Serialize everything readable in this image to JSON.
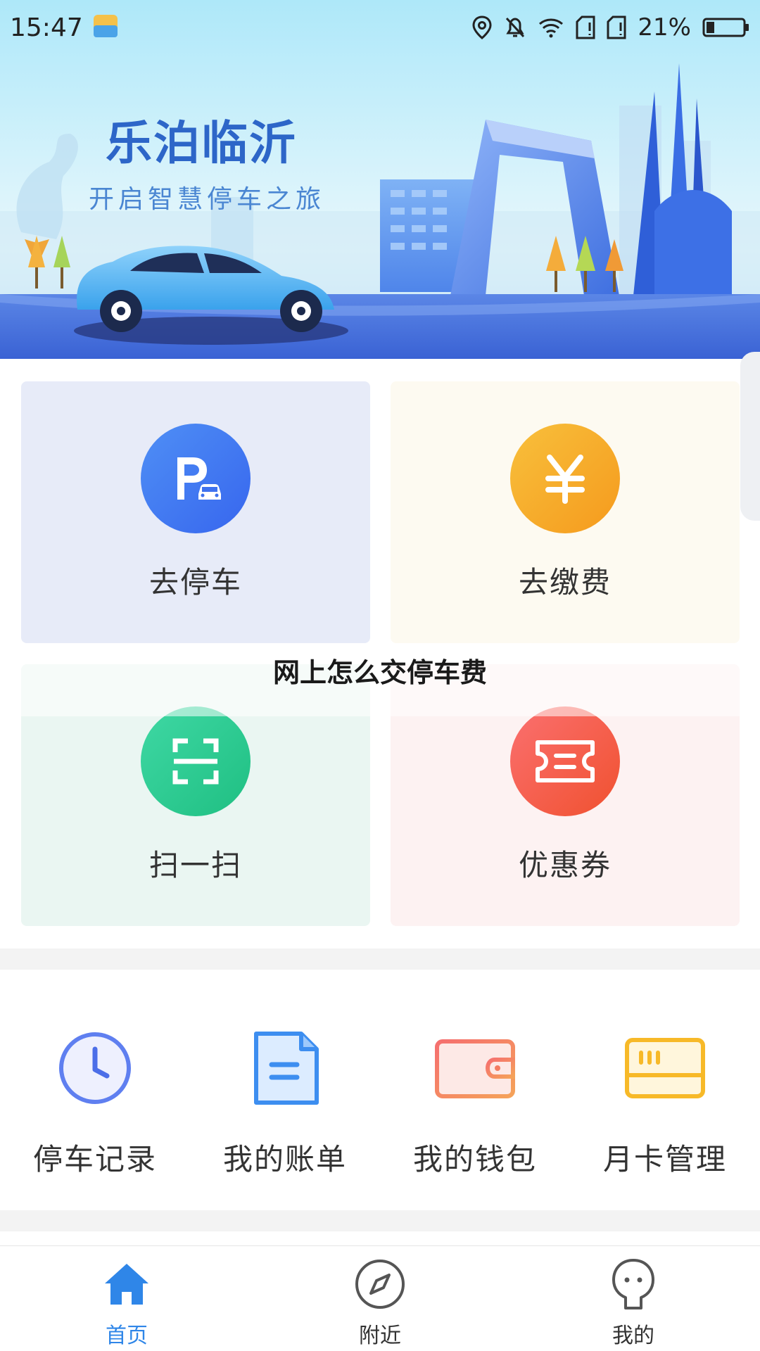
{
  "status_bar": {
    "time": "15:47",
    "battery_percent": "21%",
    "icons": [
      "weather-icon",
      "location-icon",
      "bell-off-icon",
      "wifi-icon",
      "sim1-icon",
      "sim2-icon",
      "battery-icon"
    ]
  },
  "banner": {
    "title": "乐泊临沂",
    "subtitle": "开启智慧停车之旅"
  },
  "tiles": [
    {
      "label": "去停车",
      "icon": "parking-car-icon"
    },
    {
      "label": "去缴费",
      "icon": "yuan-icon"
    },
    {
      "label": "扫一扫",
      "icon": "scan-icon"
    },
    {
      "label": "优惠券",
      "icon": "ticket-icon"
    }
  ],
  "overlay_title": "网上怎么交停车费",
  "quick_links": [
    {
      "label": "停车记录",
      "icon": "clock-icon"
    },
    {
      "label": "我的账单",
      "icon": "bill-icon"
    },
    {
      "label": "我的钱包",
      "icon": "wallet-icon"
    },
    {
      "label": "月卡管理",
      "icon": "card-icon"
    }
  ],
  "bottom_nav": [
    {
      "label": "首页",
      "icon": "home-icon",
      "active": true
    },
    {
      "label": "附近",
      "icon": "compass-icon",
      "active": false
    },
    {
      "label": "我的",
      "icon": "profile-icon",
      "active": false
    }
  ],
  "colors": {
    "accent": "#2f86e8",
    "park_tile": "#e7ebf8",
    "pay_tile": "#fdfaf1",
    "scan_tile": "#eaf6f2",
    "coupon_tile": "#fdf2f2"
  }
}
